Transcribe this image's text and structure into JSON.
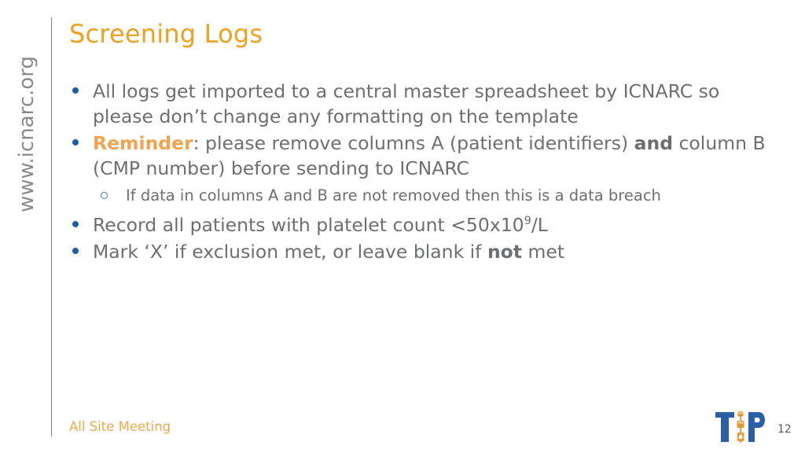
{
  "slide": {
    "title": "Screening Logs",
    "side_url": "www.icnarc.org",
    "footer_label": "All Site Meeting",
    "page_number": "12",
    "logo_name": "TIP",
    "colors": {
      "title_orange": "#F0A01E",
      "accent_orange": "#F2A34F",
      "body_gray": "#6D6E70",
      "bullet_blue": "#1B5FA8",
      "subbullet_blue": "#3C7CC4",
      "footer_orange": "#F0A94F",
      "rule_gray": "#808080",
      "logo_blue": "#2B5FA8",
      "logo_orange": "#E8952E"
    }
  },
  "bullets": [
    {
      "level": 1,
      "marker": "dot",
      "segments": [
        {
          "text": "All logs get imported to a central master spreadsheet by ICNARC so please don’t change any formatting on the template",
          "style": "normal"
        }
      ]
    },
    {
      "level": 1,
      "marker": "dot",
      "segments": [
        {
          "text": "Reminder",
          "style": "orange-bold"
        },
        {
          "text": ": please remove columns A (patient identifiers) ",
          "style": "normal"
        },
        {
          "text": "and",
          "style": "bold"
        },
        {
          "text": " column B (CMP number) before sending to ICNARC",
          "style": "normal"
        }
      ]
    },
    {
      "level": 2,
      "marker": "circle",
      "segments": [
        {
          "text": "If data in columns A and B are not removed then this is a data breach",
          "style": "normal"
        }
      ]
    },
    {
      "level": 1,
      "marker": "dot",
      "segments": [
        {
          "text": "Record all patients with platelet count <50x10",
          "style": "normal"
        },
        {
          "text": "9",
          "style": "superscript"
        },
        {
          "text": "/L",
          "style": "normal"
        }
      ]
    },
    {
      "level": 1,
      "marker": "dot",
      "segments": [
        {
          "text": "Mark ‘X’ if exclusion met, or leave blank if ",
          "style": "normal"
        },
        {
          "text": "not",
          "style": "bold"
        },
        {
          "text": " met",
          "style": "normal"
        }
      ]
    }
  ]
}
